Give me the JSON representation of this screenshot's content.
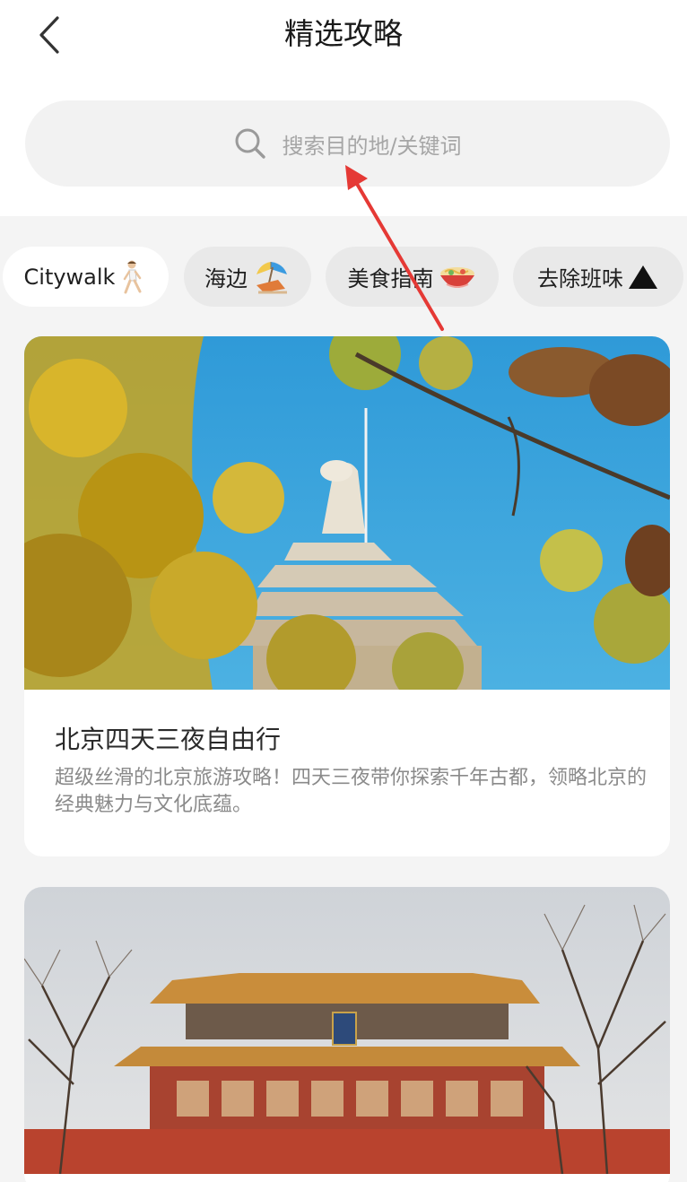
{
  "header": {
    "title": "精选攻略",
    "back_icon": "chevron-left-icon"
  },
  "search": {
    "placeholder": "搜索目的地/关键词",
    "icon": "search-icon"
  },
  "tags": [
    {
      "label": "Citywalk",
      "emoji": "person-walking",
      "active": true
    },
    {
      "label": "海边",
      "emoji": "beach-umbrella-chair",
      "active": false
    },
    {
      "label": "美食指南",
      "emoji": "noodle-bowl",
      "active": false
    },
    {
      "label": "去除班味",
      "emoji": "black-triangle",
      "active": false
    }
  ],
  "articles": [
    {
      "image": "ginkgo-tree-and-white-pagoda-blue-sky",
      "title": "北京四天三夜自由行",
      "description": "超级丝滑的北京旅游攻略！四天三夜带你探索千年古都，领略北京的经典魅力与文化底蕴。"
    },
    {
      "image": "chinese-palace-gate-tower-bare-trees",
      "title": "",
      "description": ""
    }
  ],
  "colors": {
    "page_background": "#f4f4f4",
    "annotation_arrow": "#e53935",
    "sky": "#3aa6dc",
    "palace_red": "#b6432e"
  }
}
